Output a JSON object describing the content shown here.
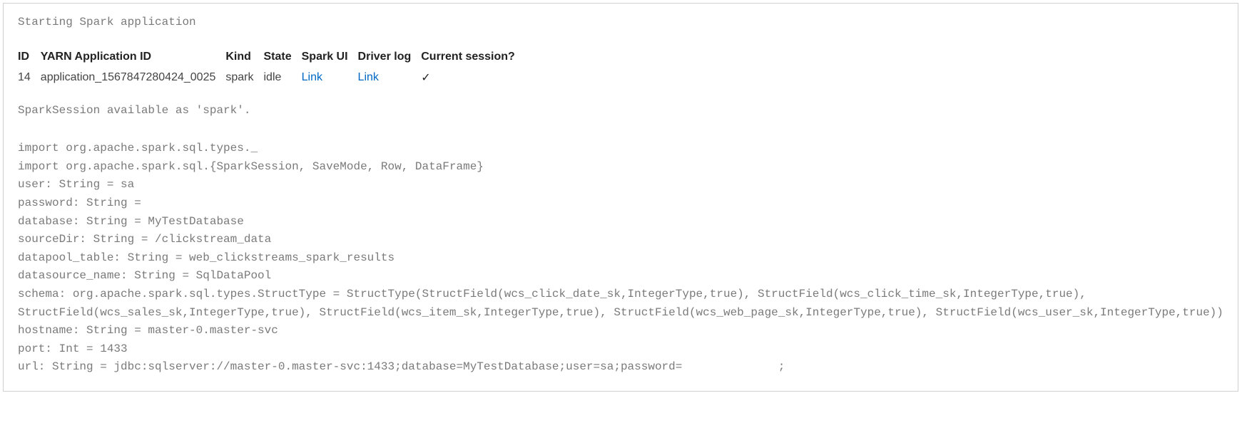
{
  "starting_text": "Starting Spark application",
  "table": {
    "headers": {
      "id": "ID",
      "yarn_app_id": "YARN Application ID",
      "kind": "Kind",
      "state": "State",
      "spark_ui": "Spark UI",
      "driver_log": "Driver log",
      "current_session": "Current session?"
    },
    "row": {
      "id": "14",
      "yarn_app_id": "application_1567847280424_0025",
      "kind": "spark",
      "state": "idle",
      "spark_ui_link": "Link",
      "driver_log_link": "Link",
      "current_session": "✓"
    }
  },
  "session_text": "SparkSession available as 'spark'.",
  "code_output": "import org.apache.spark.sql.types._\nimport org.apache.spark.sql.{SparkSession, SaveMode, Row, DataFrame}\nuser: String = sa\npassword: String =\ndatabase: String = MyTestDatabase\nsourceDir: String = /clickstream_data\ndatapool_table: String = web_clickstreams_spark_results\ndatasource_name: String = SqlDataPool\nschema: org.apache.spark.sql.types.StructType = StructType(StructField(wcs_click_date_sk,IntegerType,true), StructField(wcs_click_time_sk,IntegerType,true), StructField(wcs_sales_sk,IntegerType,true), StructField(wcs_item_sk,IntegerType,true), StructField(wcs_web_page_sk,IntegerType,true), StructField(wcs_user_sk,IntegerType,true))\nhostname: String = master-0.master-svc\nport: Int = 1433\nurl: String = jdbc:sqlserver://master-0.master-svc:1433;database=MyTestDatabase;user=sa;password=              ;"
}
